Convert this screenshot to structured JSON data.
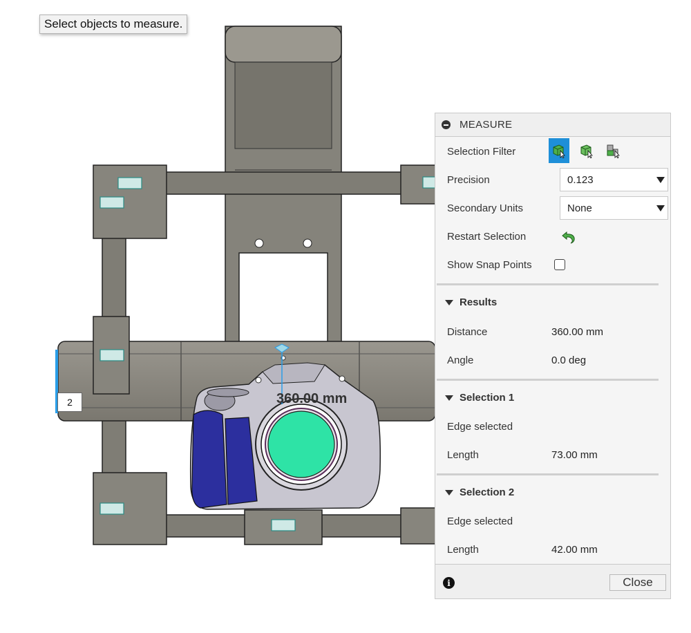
{
  "viewport": {
    "tooltip": "Select objects to measure.",
    "marker_label": "2",
    "dimension_text": "360.00 mm"
  },
  "panel": {
    "title": "MEASURE",
    "selection_filter_label": "Selection Filter",
    "filter_icons": [
      "body-select-icon",
      "face-select-icon",
      "component-select-icon"
    ],
    "precision_label": "Precision",
    "precision_value": "0.123",
    "secondary_units_label": "Secondary Units",
    "secondary_units_value": "None",
    "restart_label": "Restart Selection",
    "snap_label": "Show Snap Points",
    "snap_checked": false,
    "results": {
      "header": "Results",
      "distance_label": "Distance",
      "distance_value": "360.00 mm",
      "angle_label": "Angle",
      "angle_value": "0.0 deg"
    },
    "selection1": {
      "header": "Selection 1",
      "status": "Edge selected",
      "length_label": "Length",
      "length_value": "73.00 mm"
    },
    "selection2": {
      "header": "Selection 2",
      "status": "Edge selected",
      "length_label": "Length",
      "length_value": "42.00 mm"
    },
    "close_label": "Close",
    "accent_color": "#1e8fd8"
  }
}
